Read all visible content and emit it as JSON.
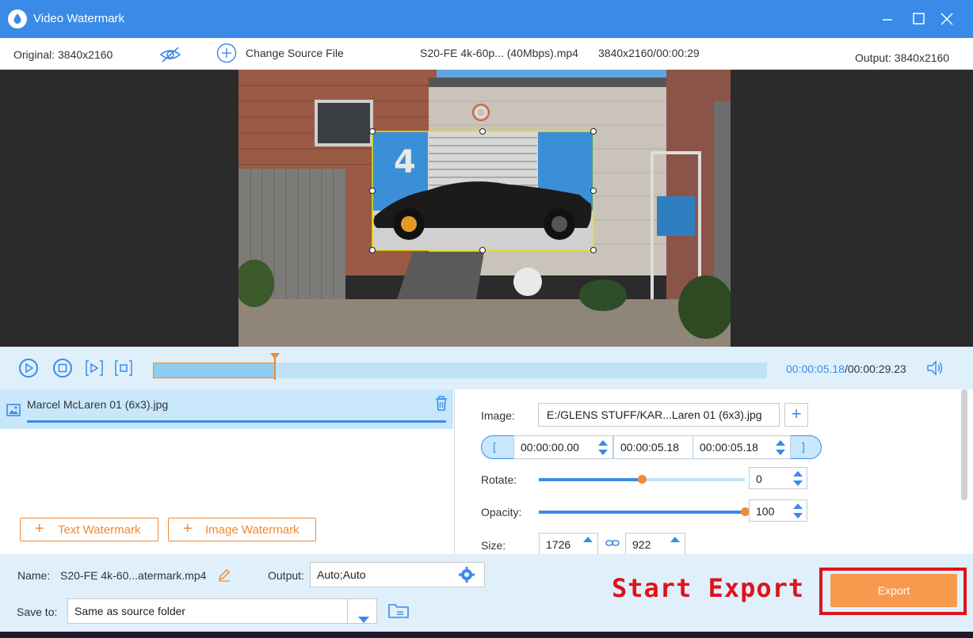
{
  "window": {
    "title": "Video Watermark",
    "minimize_icon": "minimize-icon",
    "maximize_icon": "maximize-icon",
    "close_icon": "close-icon"
  },
  "infobar": {
    "original_label": "Original: 3840x2160",
    "change_source_label": "Change Source File",
    "file_name": "S20-FE 4k-60p... (40Mbps).mp4",
    "file_info": "3840x2160/00:00:29",
    "output_label": "Output: 3840x2160"
  },
  "preview": {
    "watermark_image_number": "4"
  },
  "playback": {
    "current_time": "00:00:05.18",
    "total_time": "/00:00:29.23",
    "progress": 0.2
  },
  "watermark_list": {
    "items": [
      {
        "name": "Marcel McLaren 01 (6x3).jpg"
      }
    ],
    "text_watermark_label": "Text Watermark",
    "image_watermark_label": "Image Watermark"
  },
  "properties": {
    "image_label": "Image:",
    "image_path": "E:/GLENS STUFF/KAR...Laren 01 (6x3).jpg",
    "start_time": "00:00:00.00",
    "duration": "00:00:05.18",
    "end_time": "00:00:05.18",
    "rotate_label": "Rotate:",
    "rotate_value": "0",
    "rotate_fraction": 0.5,
    "opacity_label": "Opacity:",
    "opacity_value": "100",
    "opacity_fraction": 1.0,
    "size_label": "Size:",
    "size_width": "1726",
    "size_height": "922"
  },
  "output": {
    "name_label": "Name:",
    "name_value": "S20-FE 4k-60...atermark.mp4",
    "output_label": "Output:",
    "output_value": "Auto;Auto",
    "save_to_label": "Save to:",
    "save_to_value": "Same as source folder",
    "export_label": "Export",
    "annotation": "Start Export"
  },
  "colors": {
    "accent": "#3a8be8",
    "orange": "#f08a33",
    "export": "#f79a4e",
    "annotation_red": "#e0121b"
  }
}
